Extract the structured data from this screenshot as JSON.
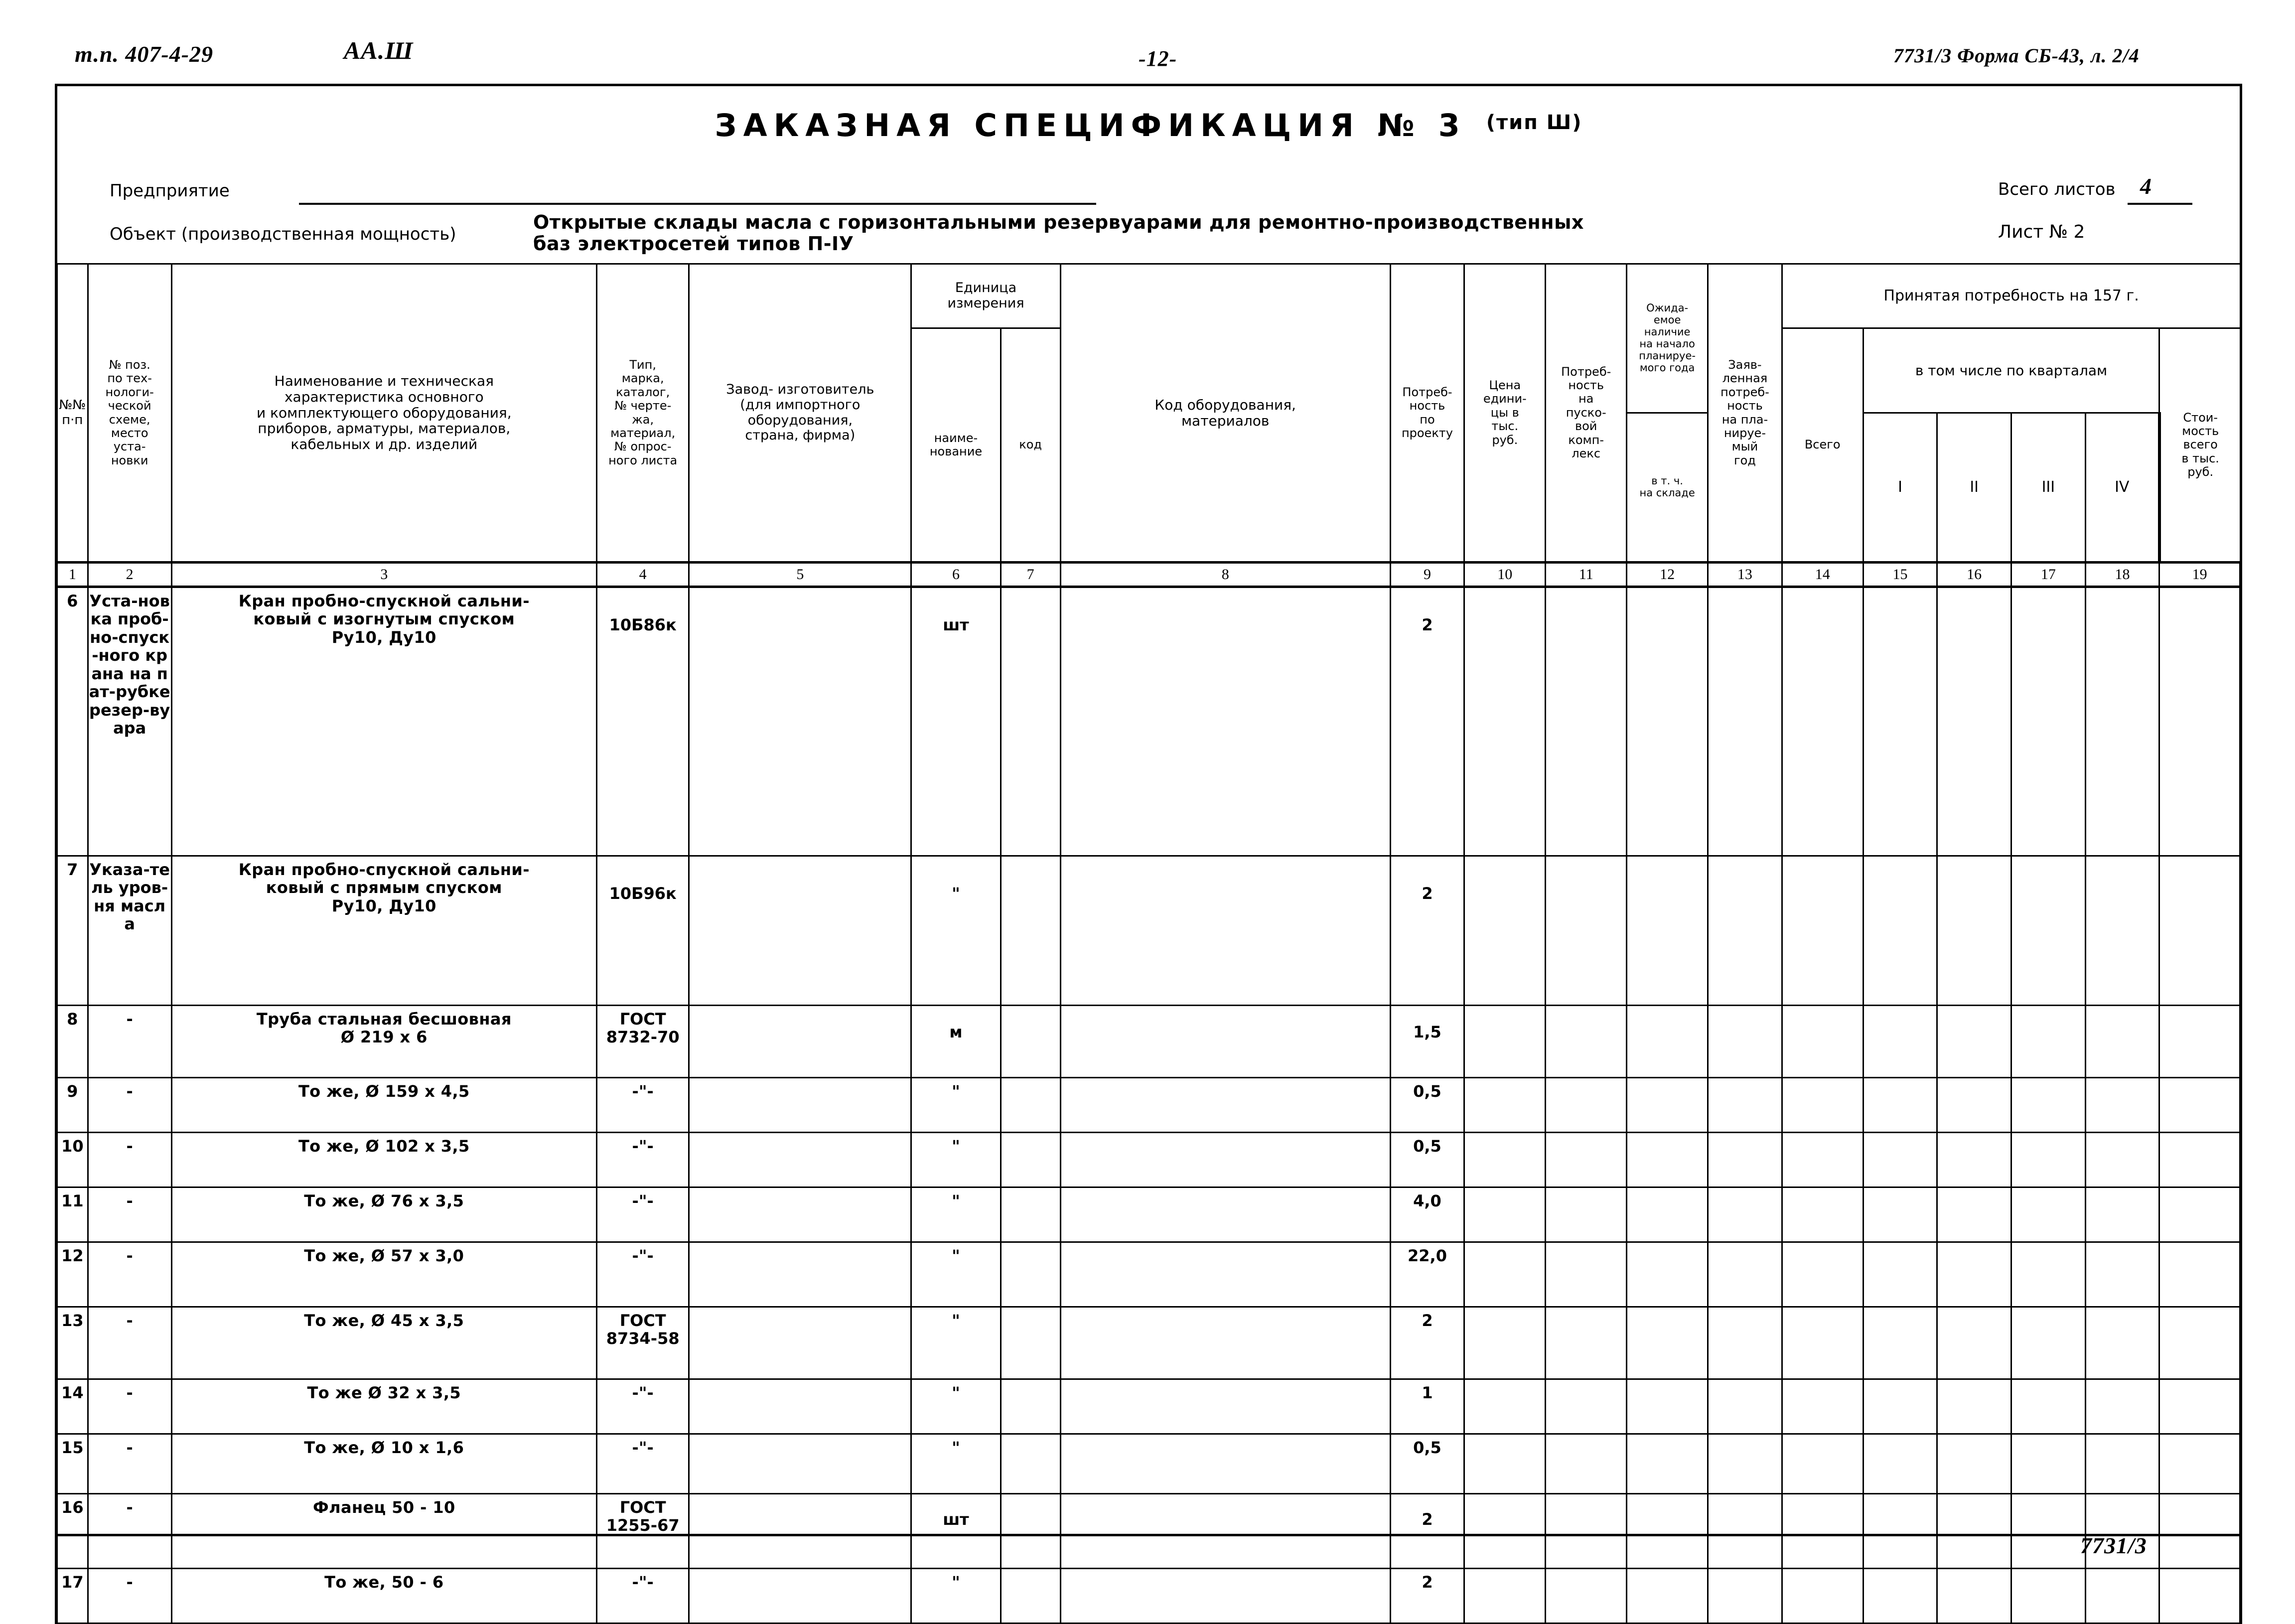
{
  "top_annotations": {
    "doc_code": "т.п. 407-4-29",
    "series_code": "АА.Ш",
    "page_number": "-12-",
    "form_code": "7731/3 Форма СБ-43, л. 2/4"
  },
  "title": {
    "main": "ЗАКАЗНАЯ СПЕЦИФИКАЦИЯ № 3",
    "type": "(тип Ш)"
  },
  "meta": {
    "enterprise_label": "Предприятие",
    "object_label": "Объект (производственная мощность)",
    "object_value": "Открытые склады масла с горизонтальными резервуарами для ремонтно-производственных\nбаз электросетей типов П-IУ",
    "total_sheets_label": "Всего листов",
    "total_sheets_value": "4",
    "sheet_no_label": "Лист № 2"
  },
  "table": {
    "headers": {
      "col1": "№№\nп·п",
      "col2": "№ поз.\nпо тех-\nнологи-\nческой\nсхеме,\nместо\nуста-\nновки",
      "col3": "Наименование и техническая\nхарактеристика основного\nи комплектующего оборудования,\nприборов, арматуры, материалов,\nкабельных и др. изделий",
      "col4": "Тип,\nмарка,\nкаталог,\n№ черте-\nжа,\nматериал,\n№ опрос-\nного листа",
      "col5": "Завод- изготовитель\n(для импортного\nоборудования,\nстрана, фирма)",
      "col6_group": "Единица\nизмерения",
      "col6": "наиме-\nнование",
      "col7": "код",
      "col8": "Код оборудования,\nматериалов",
      "col9": "Потреб-\nность\nпо\nпроекту",
      "col10": "Цена\nедини-\nцы в\nтыс.\nруб.",
      "col11": "Потреб-\nность\nна\nпуско-\nвой\nкомп-\nлекс",
      "col12a": "Ожида-\nемое\nналичие\nна начало\nпланируе-\nмого года",
      "col12b": "в т. ч.\nна складе",
      "col13": "Заяв-\nленная\nпотреб-\nность\nна пла-\nнируе-\nмый\nгод",
      "col14_19_group": "Принятая потребность на 157  г.",
      "col14": "Всего",
      "col15_18_group": "в том числе по кварталам",
      "col15": "I",
      "col16": "II",
      "col17": "III",
      "col18": "IV",
      "col19": "Стои-\nмость\nвсего\nв тыс.\nруб."
    },
    "column_numbers": [
      "1",
      "2",
      "3",
      "4",
      "5",
      "6",
      "7",
      "8",
      "9",
      "10",
      "11",
      "12",
      "13",
      "14",
      "15",
      "16",
      "17",
      "18",
      "19"
    ],
    "rows": [
      {
        "num": "6",
        "position": "Уста-новка проб-но-спуск-ного крана на пат-рубке резер-вуара",
        "name": "Кран пробно-спускной сальни-\nковый с изогнутым спуском\n        Ру10, Ду10",
        "type": "10Б86к",
        "manufacturer": "",
        "unit_name": "шт",
        "unit_code": "",
        "equipment_code": "",
        "qty_project": "2",
        "unit_price": "",
        "qty_startup": "",
        "expected_stock": "",
        "expected_warehouse": "",
        "declared_need": "",
        "accepted_total": "",
        "q1": "",
        "q2": "",
        "q3": "",
        "q4": "",
        "cost_total": ""
      },
      {
        "num": "7",
        "position": "Указа-тель уров-ня масла",
        "name": "Кран пробно-спускной сальни-\nковый с прямым спуском\n        Ру10, Ду10",
        "type": "10Б96к",
        "manufacturer": "",
        "unit_name": "\"",
        "unit_code": "",
        "equipment_code": "",
        "qty_project": "2",
        "unit_price": "",
        "qty_startup": "",
        "expected_stock": "",
        "expected_warehouse": "",
        "declared_need": "",
        "accepted_total": "",
        "q1": "",
        "q2": "",
        "q3": "",
        "q4": "",
        "cost_total": ""
      },
      {
        "num": "8",
        "position": "-",
        "name": "Труба стальная бесшовная\n       Ø 219 х 6",
        "type": "ГОСТ\n8732-70",
        "manufacturer": "",
        "unit_name": "м",
        "unit_code": "",
        "equipment_code": "",
        "qty_project": "1,5",
        "unit_price": "",
        "qty_startup": "",
        "expected_stock": "",
        "expected_warehouse": "",
        "declared_need": "",
        "accepted_total": "",
        "q1": "",
        "q2": "",
        "q3": "",
        "q4": "",
        "cost_total": ""
      },
      {
        "num": "9",
        "position": "-",
        "name": "То же,    Ø 159 х 4,5",
        "type": "-\"-",
        "manufacturer": "",
        "unit_name": "\"",
        "unit_code": "",
        "equipment_code": "",
        "qty_project": "0,5",
        "unit_price": "",
        "qty_startup": "",
        "expected_stock": "",
        "expected_warehouse": "",
        "declared_need": "",
        "accepted_total": "",
        "q1": "",
        "q2": "",
        "q3": "",
        "q4": "",
        "cost_total": ""
      },
      {
        "num": "10",
        "position": "-",
        "name": "То же,    Ø 102 х 3,5",
        "type": "-\"-",
        "manufacturer": "",
        "unit_name": "\"",
        "unit_code": "",
        "equipment_code": "",
        "qty_project": "0,5",
        "unit_price": "",
        "qty_startup": "",
        "expected_stock": "",
        "expected_warehouse": "",
        "declared_need": "",
        "accepted_total": "",
        "q1": "",
        "q2": "",
        "q3": "",
        "q4": "",
        "cost_total": ""
      },
      {
        "num": "11",
        "position": "-",
        "name": "То же,    Ø  76 х 3,5",
        "type": "-\"-",
        "manufacturer": "",
        "unit_name": "\"",
        "unit_code": "",
        "equipment_code": "",
        "qty_project": "4,0",
        "unit_price": "",
        "qty_startup": "",
        "expected_stock": "",
        "expected_warehouse": "",
        "declared_need": "",
        "accepted_total": "",
        "q1": "",
        "q2": "",
        "q3": "",
        "q4": "",
        "cost_total": ""
      },
      {
        "num": "12",
        "position": "-",
        "name": "То же,    Ø  57 х 3,0",
        "type": "-\"-",
        "manufacturer": "",
        "unit_name": "\"",
        "unit_code": "",
        "equipment_code": "",
        "qty_project": "22,0",
        "unit_price": "",
        "qty_startup": "",
        "expected_stock": "",
        "expected_warehouse": "",
        "declared_need": "",
        "accepted_total": "",
        "q1": "",
        "q2": "",
        "q3": "",
        "q4": "",
        "cost_total": ""
      },
      {
        "num": "13",
        "position": "-",
        "name": "То же,    Ø  45 х 3,5",
        "type": "ГОСТ\n8734-58",
        "manufacturer": "",
        "unit_name": "\"",
        "unit_code": "",
        "equipment_code": "",
        "qty_project": "2",
        "unit_price": "",
        "qty_startup": "",
        "expected_stock": "",
        "expected_warehouse": "",
        "declared_need": "",
        "accepted_total": "",
        "q1": "",
        "q2": "",
        "q3": "",
        "q4": "",
        "cost_total": ""
      },
      {
        "num": "14",
        "position": "-",
        "name": "То же     Ø 32 х 3,5",
        "type": "-\"-",
        "manufacturer": "",
        "unit_name": "\"",
        "unit_code": "",
        "equipment_code": "",
        "qty_project": "1",
        "unit_price": "",
        "qty_startup": "",
        "expected_stock": "",
        "expected_warehouse": "",
        "declared_need": "",
        "accepted_total": "",
        "q1": "",
        "q2": "",
        "q3": "",
        "q4": "",
        "cost_total": ""
      },
      {
        "num": "15",
        "position": "-",
        "name": "То же,    Ø 10 х 1,6",
        "type": "-\"-",
        "manufacturer": "",
        "unit_name": "\"",
        "unit_code": "",
        "equipment_code": "",
        "qty_project": "0,5",
        "unit_price": "",
        "qty_startup": "",
        "expected_stock": "",
        "expected_warehouse": "",
        "declared_need": "",
        "accepted_total": "",
        "q1": "",
        "q2": "",
        "q3": "",
        "q4": "",
        "cost_total": ""
      },
      {
        "num": "16",
        "position": "-",
        "name": "Фланец 50 - 10",
        "type": "ГОСТ\n1255-67",
        "manufacturer": "",
        "unit_name": "шт",
        "unit_code": "",
        "equipment_code": "",
        "qty_project": "2",
        "unit_price": "",
        "qty_startup": "",
        "expected_stock": "",
        "expected_warehouse": "",
        "declared_need": "",
        "accepted_total": "",
        "q1": "",
        "q2": "",
        "q3": "",
        "q4": "",
        "cost_total": ""
      },
      {
        "num": "17",
        "position": "-",
        "name": "То же, 50 - 6",
        "type": "-\"-",
        "manufacturer": "",
        "unit_name": "\"",
        "unit_code": "",
        "equipment_code": "",
        "qty_project": "2",
        "unit_price": "",
        "qty_startup": "",
        "expected_stock": "",
        "expected_warehouse": "",
        "declared_need": "",
        "accepted_total": "",
        "q1": "",
        "q2": "",
        "q3": "",
        "q4": "",
        "cost_total": ""
      }
    ]
  },
  "bottom_stamp": "7731/3"
}
